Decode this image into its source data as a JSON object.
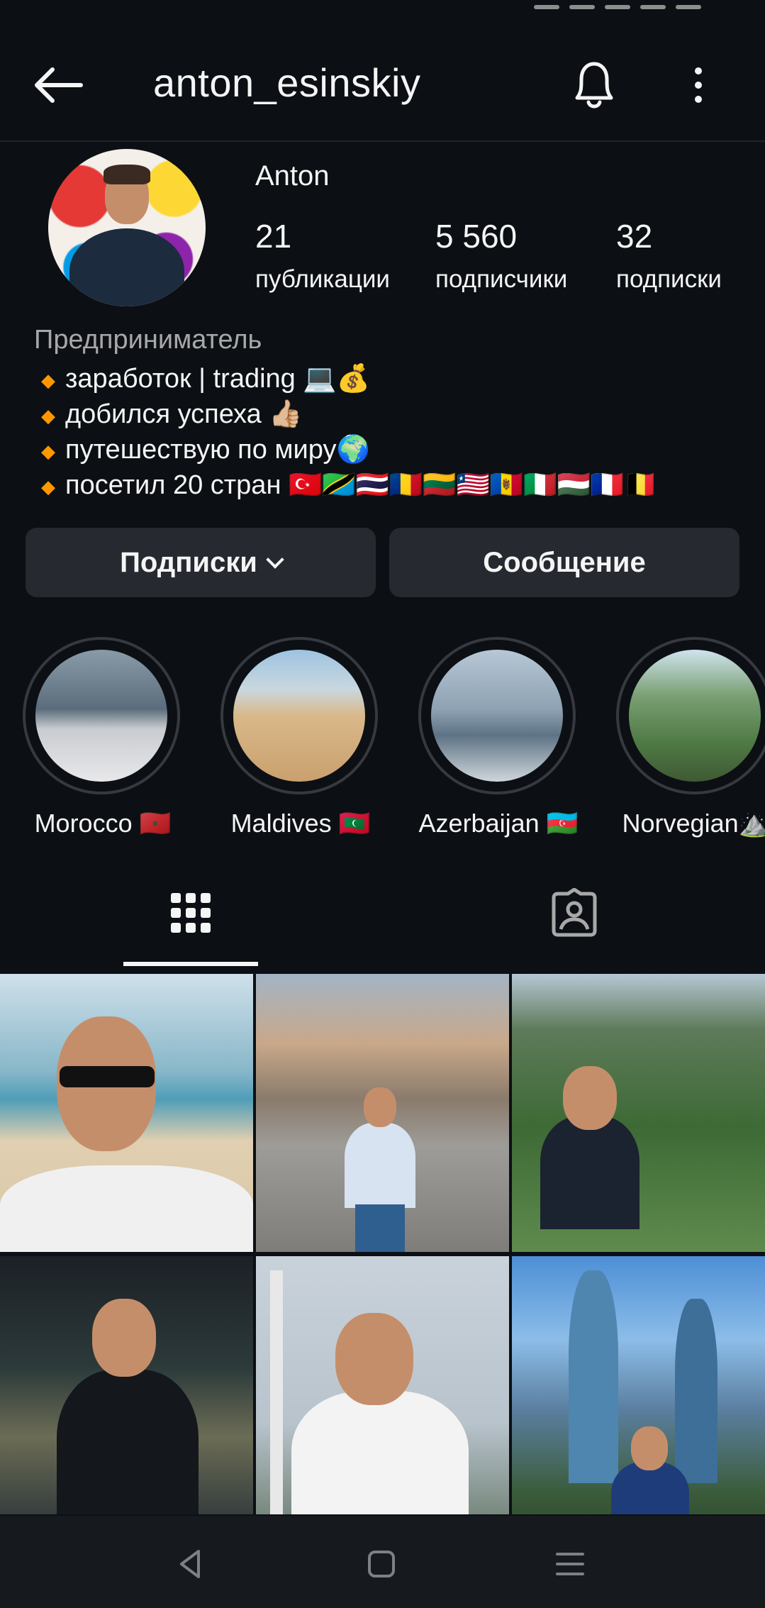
{
  "header": {
    "username": "anton_esinskiy"
  },
  "profile": {
    "display_name": "Anton",
    "stats": [
      {
        "value": "21",
        "label": "публикации"
      },
      {
        "value": "5 560",
        "label": "подписчики"
      },
      {
        "value": "32",
        "label": "подписки"
      }
    ],
    "category": "Предприниматель",
    "bio": [
      "заработок | trading 💻💰",
      "добился успеха 👍🏼",
      "путешествую по миру🌍",
      "посетил 20 стран 🇹🇷🇹🇿🇹🇭🇷🇴🇱🇹🇱🇷🇲🇩🇮🇹🇭🇺🇫🇷🇧🇪"
    ]
  },
  "actions": {
    "following_label": "Подписки",
    "message_label": "Сообщение"
  },
  "highlights": [
    {
      "label": "Morocco 🇲🇦"
    },
    {
      "label": "Maldives 🇲🇻"
    },
    {
      "label": "Azerbaijan 🇦🇿"
    },
    {
      "label": "Norvegian⛰️"
    }
  ],
  "tabs": {
    "active": "grid",
    "icons": [
      "grid-icon",
      "tagged-icon"
    ]
  },
  "colors": {
    "background": "#0c1014",
    "button": "#262a30",
    "accent_bullet": "#ff9800",
    "secondary_text": "#a8a8a8"
  },
  "navbar": {
    "icons": [
      "back-triangle-icon",
      "home-square-icon",
      "recents-icon"
    ]
  }
}
